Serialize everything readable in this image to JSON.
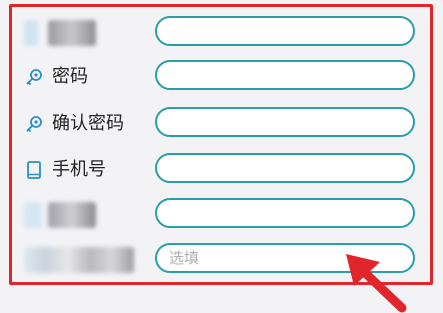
{
  "form": {
    "rows": [
      {
        "label": "",
        "value": "",
        "placeholder": ""
      },
      {
        "label": "密码",
        "value": "",
        "placeholder": ""
      },
      {
        "label": "确认密码",
        "value": "",
        "placeholder": ""
      },
      {
        "label": "手机号",
        "value": "",
        "placeholder": ""
      },
      {
        "label": "",
        "value": "",
        "placeholder": ""
      },
      {
        "label": "",
        "value": "",
        "placeholder": "选填"
      }
    ]
  },
  "icons": {
    "password": "key-icon",
    "confirm_password": "key-icon",
    "phone": "phone-icon"
  },
  "colors": {
    "field_border": "#2a9ea8",
    "highlight_box": "#e0262a",
    "arrow": "#e0262a",
    "icon": "#2a8fc4"
  }
}
